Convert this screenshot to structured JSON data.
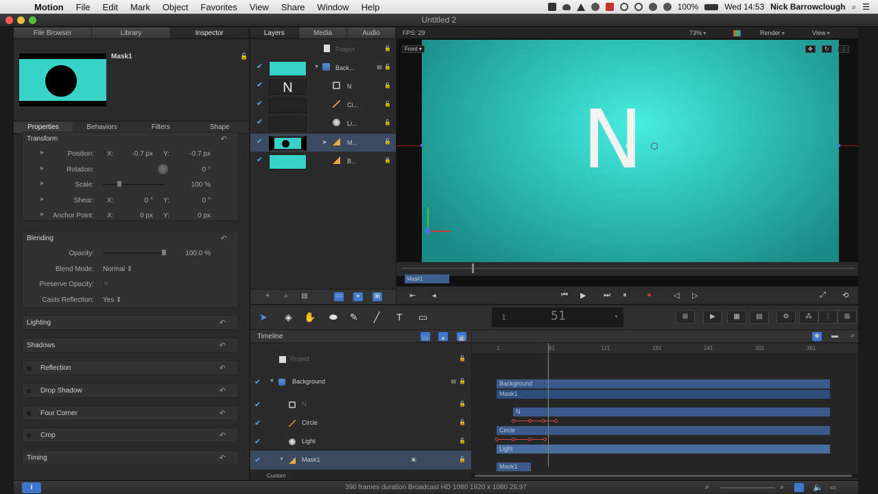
{
  "menubar": {
    "apple": "",
    "items": [
      "Motion",
      "File",
      "Edit",
      "Mark",
      "Object",
      "Favorites",
      "View",
      "Share",
      "Window",
      "Help"
    ],
    "battery": "100%",
    "clock": "Wed 14:53",
    "user": "Nick Barrowclough"
  },
  "window": {
    "title": "Untitled 2"
  },
  "left_tabs": [
    "File Browser",
    "Library",
    "Inspector"
  ],
  "inspector": {
    "preview_name": "Mask1",
    "subtabs": [
      "Properties",
      "Behaviors",
      "Filters",
      "Shape"
    ],
    "transform": {
      "title": "Transform",
      "position": {
        "label": "Position:",
        "x_label": "X:",
        "x": "-0.7 px",
        "y_label": "Y:",
        "y": "-0.7 px"
      },
      "rotation": {
        "label": "Rotation:",
        "value": "0 °"
      },
      "scale": {
        "label": "Scale:",
        "value": "100 %",
        "level_percent": 100
      },
      "shear": {
        "label": "Shear:",
        "x_label": "X:",
        "x": "0 °",
        "y_label": "Y:",
        "y": "0 °"
      },
      "anchor": {
        "label": "Anchor Point:",
        "x_label": "X:",
        "x": "0 px",
        "y_label": "Y:",
        "y": "0 px"
      }
    },
    "blending": {
      "title": "Blending",
      "opacity": {
        "label": "Opacity:",
        "value": "100.0 %",
        "level_percent": 100
      },
      "blend_mode": {
        "label": "Blend Mode:",
        "value": "Normal"
      },
      "preserve_opacity": {
        "label": "Preserve Opacity:"
      },
      "casts_reflection": {
        "label": "Casts Reflection:",
        "value": "Yes"
      }
    },
    "collapsed_groups": [
      "Lighting",
      "Shadows",
      "Reflection",
      "Drop Shadow",
      "Four Corner",
      "Crop",
      "Timing"
    ]
  },
  "mid_tabs": [
    "Layers",
    "Media",
    "Audio"
  ],
  "layers": {
    "project": "Project",
    "rows": [
      {
        "name": "Back...",
        "thumb": "teal",
        "icon": "group-icon"
      },
      {
        "name": "N",
        "thumb": "text",
        "glyph": "N",
        "icon": "text-icon"
      },
      {
        "name": "Ci...",
        "thumb": "empty",
        "icon": "line-icon"
      },
      {
        "name": "Li...",
        "thumb": "empty",
        "icon": "light-icon"
      },
      {
        "name": "M...",
        "thumb": "mask",
        "icon": "mask-icon"
      },
      {
        "name": "B...",
        "thumb": "teal",
        "icon": "mask-icon"
      }
    ]
  },
  "canvas": {
    "fps": "FPS: 29",
    "zoom": "73%",
    "render": "Render",
    "view": "View",
    "camera": "Front",
    "letter": "N",
    "mini_label": "Mask1",
    "accent": "#39d2c8"
  },
  "toolbar": {
    "timecode_small": "1",
    "timecode_big": "51"
  },
  "timeline": {
    "title": "Timeline",
    "project": "Project",
    "rows": [
      {
        "name": "Background",
        "icon": "group-icon"
      },
      {
        "name": "N",
        "icon": "text-icon"
      },
      {
        "name": "Circle",
        "icon": "line-icon"
      },
      {
        "name": "Light",
        "icon": "light-icon"
      },
      {
        "name": "Mask1",
        "icon": "mask-icon"
      }
    ],
    "custom": "Custom",
    "ruler": [
      "1",
      "61",
      "121",
      "181",
      "241",
      "301",
      "361"
    ],
    "tracks": {
      "background": "Background",
      "mask1": "Mask1",
      "n": "N",
      "circle": "Circle",
      "light": "Light",
      "mask1b": "Mask1"
    }
  },
  "status": {
    "message": "390 frames duration Broadcast HD 1080 1920 x 1080 29.97"
  }
}
